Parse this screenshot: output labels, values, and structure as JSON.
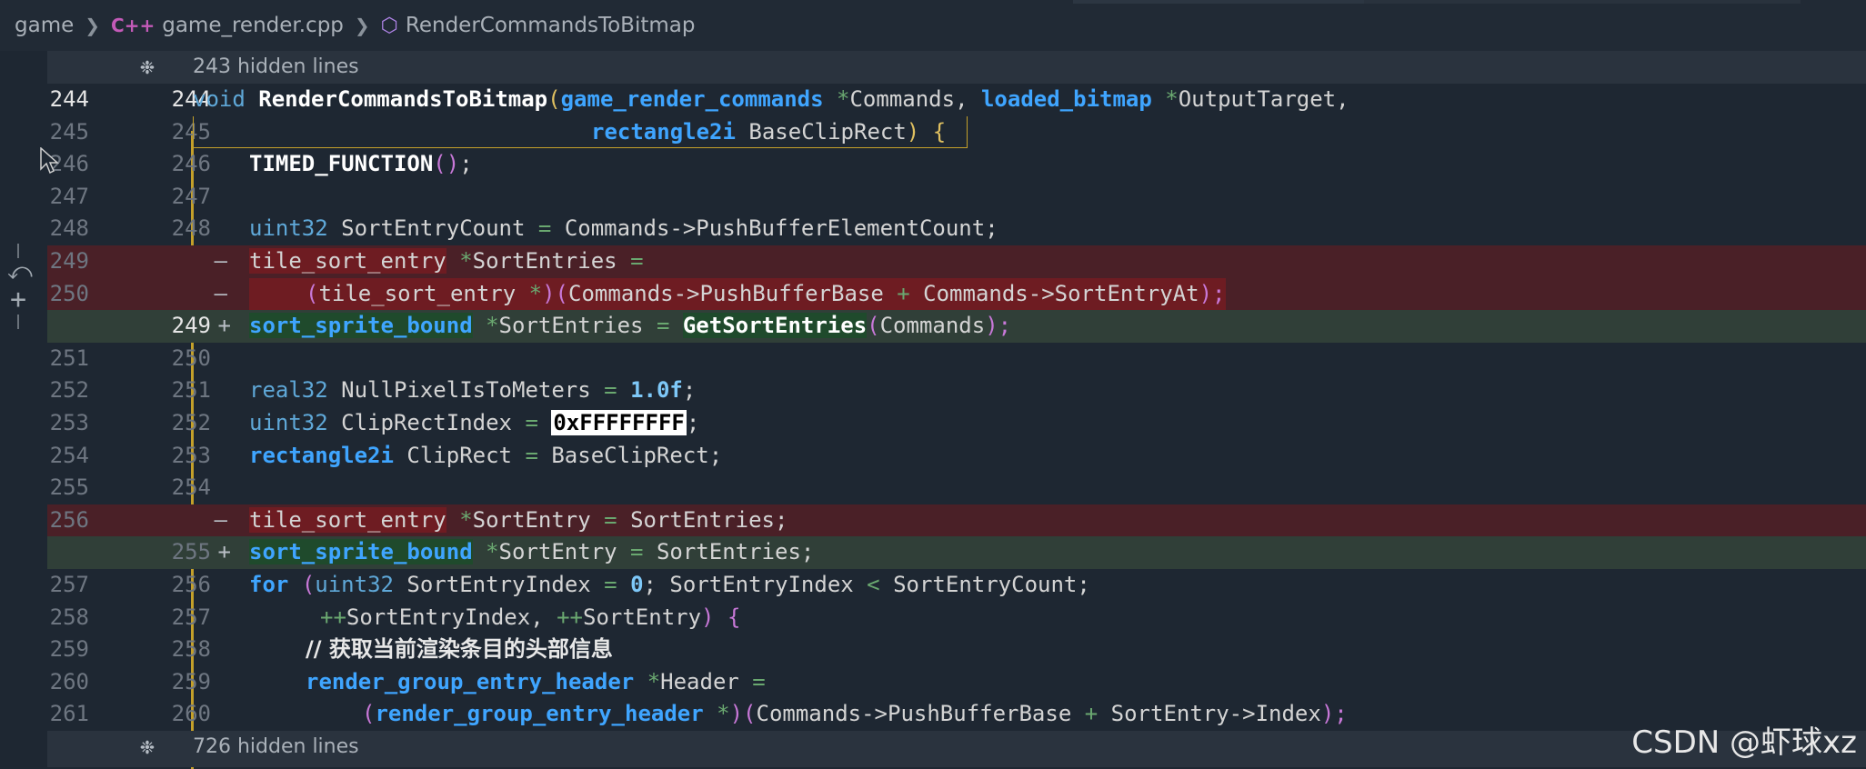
{
  "breadcrumb": {
    "folder": "game",
    "file_badge": "C++",
    "file": "game_render.cpp",
    "symbol": "RenderCommandsToBitmap"
  },
  "hidden_top": "243 hidden lines",
  "hidden_bottom": "726 hidden lines",
  "lines": [
    {
      "old": "244",
      "new": "244"
    },
    {
      "old": "245",
      "new": "245"
    },
    {
      "old": "246",
      "new": "246"
    },
    {
      "old": "247",
      "new": "247"
    },
    {
      "old": "248",
      "new": "248"
    },
    {
      "old": "249",
      "new": "",
      "marker": "—"
    },
    {
      "old": "250",
      "new": "",
      "marker": "—"
    },
    {
      "old": "",
      "new": "249",
      "marker": "+"
    },
    {
      "old": "251",
      "new": "250"
    },
    {
      "old": "252",
      "new": "251"
    },
    {
      "old": "253",
      "new": "252"
    },
    {
      "old": "254",
      "new": "253"
    },
    {
      "old": "255",
      "new": "254"
    },
    {
      "old": "256",
      "new": "",
      "marker": "—"
    },
    {
      "old": "",
      "new": "255",
      "marker": "+"
    },
    {
      "old": "257",
      "new": "256"
    },
    {
      "old": "258",
      "new": "257"
    },
    {
      "old": "259",
      "new": "258"
    },
    {
      "old": "260",
      "new": "259"
    },
    {
      "old": "261",
      "new": "260"
    }
  ],
  "code": {
    "l244": [
      "void",
      "RenderCommandsToBitmap",
      "(",
      "game_render_commands",
      "*",
      "Commands, ",
      "loaded_bitmap",
      "*",
      "OutputTarget,"
    ],
    "l245": [
      "rectangle2i",
      "BaseClipRect",
      ")",
      "{"
    ],
    "l246": [
      "TIMED_FUNCTION",
      "(",
      ")",
      ";"
    ],
    "l248": [
      "uint32",
      "SortEntryCount",
      "=",
      "Commands->PushBufferElementCount;"
    ],
    "l249": [
      "tile_sort_entry",
      "*",
      "SortEntries",
      "="
    ],
    "l250": [
      "(",
      "tile_sort_entry",
      "*",
      ")(",
      "Commands->PushBufferBase",
      "+",
      "Commands->SortEntryAt",
      ");"
    ],
    "l249n": [
      "sort_sprite_bound",
      "*",
      "SortEntries",
      "=",
      "GetSortEntries",
      "(",
      "Commands",
      ");"
    ],
    "l251": [
      "real32",
      "NullPixelIsToMeters",
      "=",
      "1.0f",
      ";"
    ],
    "l252": [
      "uint32",
      "ClipRectIndex",
      "=",
      "0xFFFFFFFF",
      ";"
    ],
    "l253": [
      "rectangle2i",
      "ClipRect",
      "=",
      "BaseClipRect;"
    ],
    "l256": [
      "tile_sort_entry",
      "*",
      "SortEntry",
      "=",
      "SortEntries;"
    ],
    "l255n": [
      "sort_sprite_bound",
      "*",
      "SortEntry",
      "=",
      "SortEntries;"
    ],
    "l257": [
      "for",
      "(",
      "uint32",
      "SortEntryIndex",
      "=",
      "0",
      "; SortEntryIndex",
      "<",
      "SortEntryCount;"
    ],
    "l258": [
      "++",
      "SortEntryIndex, ",
      "++",
      "SortEntry",
      ")",
      "{"
    ],
    "l259": [
      "// 获取当前渲染条目的头部信息"
    ],
    "l260": [
      "render_group_entry_header",
      "*",
      "Header",
      "="
    ],
    "l261": [
      "(",
      "render_group_entry_header",
      "*",
      ")(",
      "Commands->PushBufferBase",
      "+",
      "SortEntry->Index",
      ");"
    ]
  },
  "watermark": "CSDN @虾球xz"
}
